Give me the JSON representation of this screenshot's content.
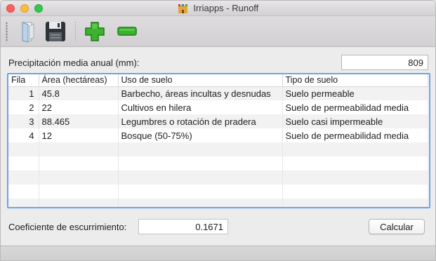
{
  "window": {
    "title": "Irriapps - Runoff",
    "icon": "castle-app-icon"
  },
  "toolbar": {
    "items": [
      {
        "name": "open-file-icon"
      },
      {
        "name": "save-icon"
      },
      {
        "name": "add-row-icon",
        "color": "#3bb32d"
      },
      {
        "name": "remove-row-icon",
        "color": "#3bb32d"
      }
    ]
  },
  "precipitation": {
    "label": "Precipitación media anual (mm):",
    "value": "809"
  },
  "table": {
    "headers": [
      "Fila",
      "Área (hectáreas)",
      "Uso de suelo",
      "Tipo de suelo"
    ],
    "rows": [
      {
        "fila": "1",
        "area": "45.8",
        "uso": "Barbecho, áreas incultas y desnudas",
        "tipo": "Suelo permeable"
      },
      {
        "fila": "2",
        "area": "22",
        "uso": "Cultivos en hilera",
        "tipo": "Suelo de permeabilidad media"
      },
      {
        "fila": "3",
        "area": "88.465",
        "uso": "Legumbres o rotación de pradera",
        "tipo": "Suelo casi impermeable"
      },
      {
        "fila": "4",
        "area": "12",
        "uso": "Bosque (50-75%)",
        "tipo": "Suelo de permeabilidad media"
      }
    ],
    "empty_rows": 5,
    "accent_color": "#6ca3e6"
  },
  "coefficient": {
    "label": "Coeficiente de escurrimiento:",
    "value": "0.1671"
  },
  "actions": {
    "calculate_label": "Calcular"
  }
}
